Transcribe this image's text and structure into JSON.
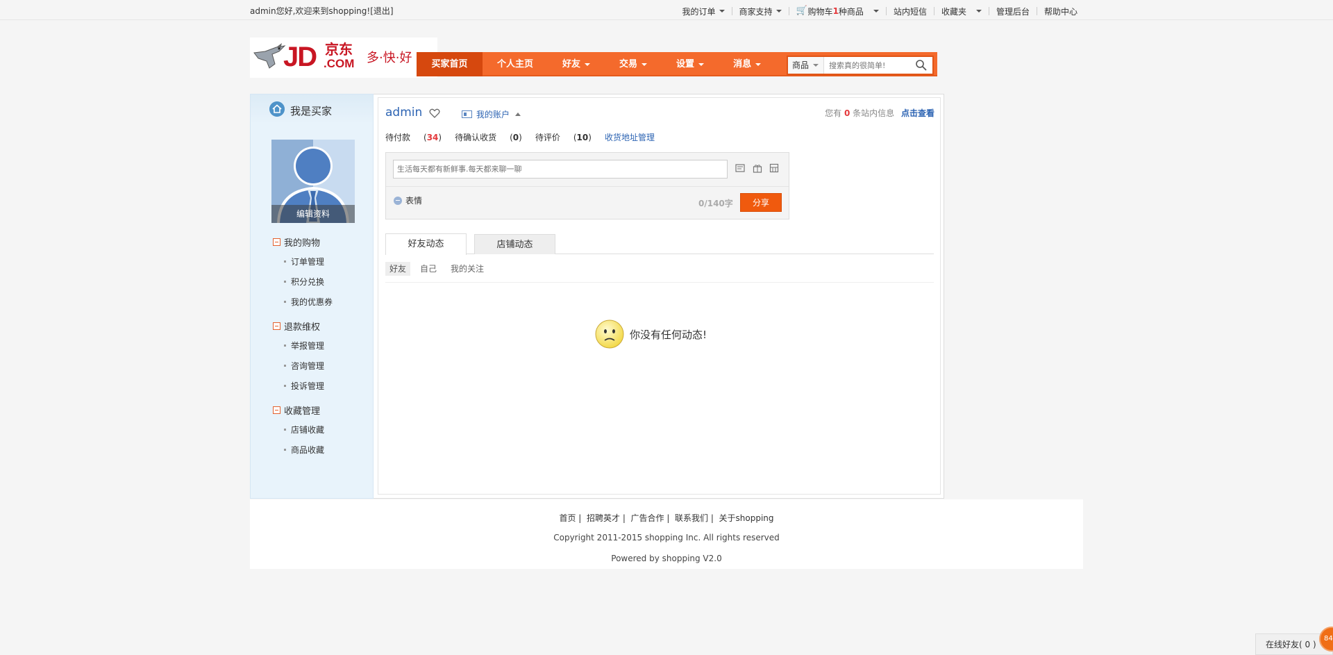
{
  "topbar": {
    "welcome": "admin您好,欢迎来到shopping!",
    "logout": "[退出]",
    "nav": [
      "我的订单",
      "商家支持",
      "站内短信",
      "收藏夹",
      "管理后台",
      "帮助中心"
    ],
    "cart_prefix": "购物车",
    "cart_count": "1",
    "cart_suffix": "种商品"
  },
  "logo": {
    "jd": "JD",
    "jd_cn": "京东",
    "com": ".COM",
    "slogan": "多·快·好"
  },
  "mainnav": {
    "tabs": [
      "买家首页",
      "个人主页",
      "好友",
      "交易",
      "设置",
      "消息"
    ]
  },
  "search": {
    "category": "商品",
    "placeholder": "搜索真的很简单!"
  },
  "sidebar": {
    "title": "我是买家",
    "edit_profile": "编辑资料",
    "groups": [
      {
        "label": "我的购物",
        "items": [
          "订单管理",
          "积分兑换",
          "我的优惠券"
        ]
      },
      {
        "label": "退款维权",
        "items": [
          "举报管理",
          "咨询管理",
          "投诉管理"
        ]
      },
      {
        "label": "收藏管理",
        "items": [
          "店铺收藏",
          "商品收藏"
        ]
      }
    ]
  },
  "profile": {
    "username": "admin",
    "account": "我的账户",
    "msg_prefix": "您有",
    "msg_count": "0",
    "msg_suffix": "条站内信息",
    "msg_view": "点击查看"
  },
  "stats": {
    "unpaid_label": "待付款",
    "unpaid": "34",
    "unconfirmed_label": "待确认收货",
    "unconfirmed": "0",
    "unrated_label": "待评价",
    "unrated": "10",
    "address": "收货地址管理"
  },
  "post": {
    "placeholder": "生活每天都有新鲜事.每天都来聊一聊",
    "emoji": "表情",
    "count": "0/140字",
    "share": "分享"
  },
  "feed": {
    "tabs": [
      "好友动态",
      "店铺动态"
    ],
    "subtabs": [
      "好友",
      "自己",
      "我的关注"
    ],
    "empty": "你没有任何动态!"
  },
  "footer": {
    "links": [
      "首页",
      "招聘英才",
      "广告合作",
      "联系我们",
      "关于shopping"
    ],
    "copyright": "Copyright 2011-2015 shopping Inc. All rights reserved",
    "powered": "Powered by shopping V2.0"
  },
  "online": {
    "label": "在线好友( 0 )",
    "badge": "84"
  },
  "colors": {
    "nav": "#f46a2c",
    "nav_active": "#d6480e",
    "accent_red": "#e4393c",
    "link_blue": "#2d64b3",
    "share_btn": "#f05a0e"
  }
}
